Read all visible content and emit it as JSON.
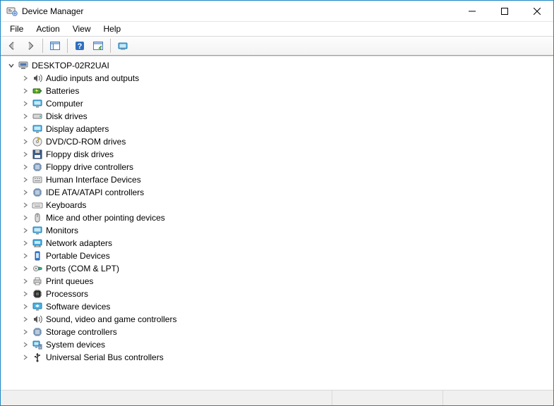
{
  "window": {
    "title": "Device Manager"
  },
  "menus": {
    "file": "File",
    "action": "Action",
    "view": "View",
    "help": "Help"
  },
  "tree": {
    "root": {
      "label": "DESKTOP-02R2UAI",
      "expanded": true
    },
    "categories": [
      {
        "label": "Audio inputs and outputs",
        "icon": "speaker"
      },
      {
        "label": "Batteries",
        "icon": "battery"
      },
      {
        "label": "Computer",
        "icon": "monitor"
      },
      {
        "label": "Disk drives",
        "icon": "disk"
      },
      {
        "label": "Display adapters",
        "icon": "monitor"
      },
      {
        "label": "DVD/CD-ROM drives",
        "icon": "disc"
      },
      {
        "label": "Floppy disk drives",
        "icon": "floppy"
      },
      {
        "label": "Floppy drive controllers",
        "icon": "chip"
      },
      {
        "label": "Human Interface Devices",
        "icon": "hid"
      },
      {
        "label": "IDE ATA/ATAPI controllers",
        "icon": "chip"
      },
      {
        "label": "Keyboards",
        "icon": "keyboard"
      },
      {
        "label": "Mice and other pointing devices",
        "icon": "mouse"
      },
      {
        "label": "Monitors",
        "icon": "monitor"
      },
      {
        "label": "Network adapters",
        "icon": "network"
      },
      {
        "label": "Portable Devices",
        "icon": "portable"
      },
      {
        "label": "Ports (COM & LPT)",
        "icon": "port"
      },
      {
        "label": "Print queues",
        "icon": "printer"
      },
      {
        "label": "Processors",
        "icon": "cpu"
      },
      {
        "label": "Software devices",
        "icon": "software"
      },
      {
        "label": "Sound, video and game controllers",
        "icon": "speaker"
      },
      {
        "label": "Storage controllers",
        "icon": "chip"
      },
      {
        "label": "System devices",
        "icon": "system"
      },
      {
        "label": "Universal Serial Bus controllers",
        "icon": "usb"
      }
    ]
  }
}
